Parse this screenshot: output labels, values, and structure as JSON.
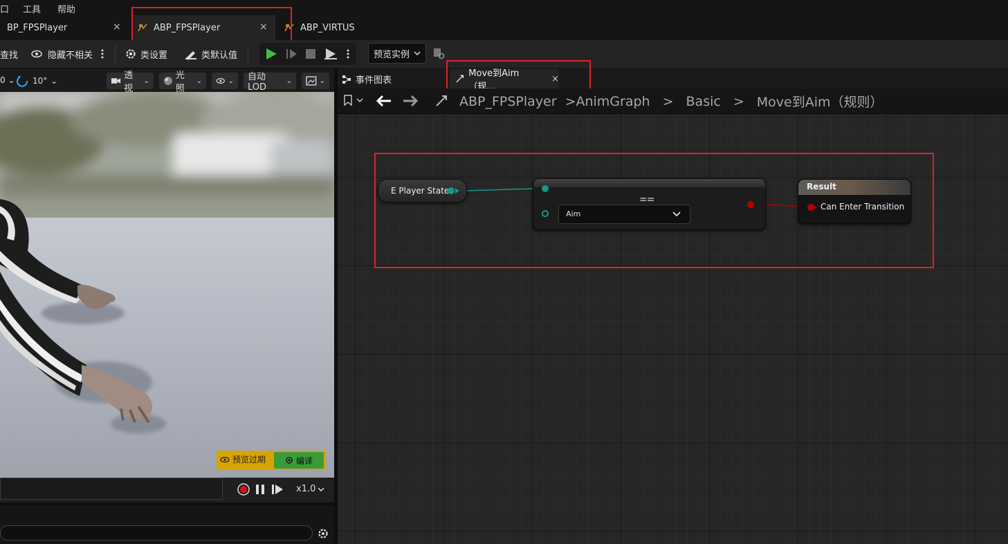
{
  "menu": {
    "items": [
      "口",
      "工具",
      "帮助"
    ]
  },
  "tabs": [
    {
      "label": "BP_FPSPlayer",
      "close": "×"
    },
    {
      "label": "ABP_FPSPlayer",
      "close": "×"
    },
    {
      "label": "ABP_VIRTUS"
    }
  ],
  "toolbar": {
    "find_label": "查找",
    "hide_unrelated_label": "隐藏不相关",
    "class_settings_label": "类设置",
    "class_defaults_label": "类默认值",
    "preview_instance_label": "预览实例"
  },
  "viewport_toolbar": {
    "left_value": "0",
    "rotation_snap": "10°",
    "perspective_label": "透视",
    "lighting_label": "光照",
    "lod_label": "自动LOD"
  },
  "viewport": {
    "preview_badge_label": "预览过期",
    "compile_label": "编译"
  },
  "timeline": {
    "speed_label": "x1.0"
  },
  "graph_tabs": {
    "event_graph_label": "事件图表",
    "rule_tab_label": "Move到Aim（规...",
    "rule_tab_close": "×"
  },
  "breadcrumb": {
    "items": [
      "ABP_FPSPlayer",
      "AnimGraph",
      "Basic",
      "Move到Aim（规则）"
    ],
    "separator": ">"
  },
  "nodes": {
    "player_state_label": "E Player State",
    "equal_symbol": "==",
    "enum_value": "Aim",
    "result_title": "Result",
    "result_pin_label": "Can Enter Transition"
  },
  "colors": {
    "highlight_red": "#e0202a",
    "enum_pin_teal": "#0f9a8a",
    "bool_pin_red": "#b30000",
    "play_green": "#3fbf3f",
    "preview_badge_yellow": "#d9a400",
    "compile_green": "#3a9b3a"
  }
}
